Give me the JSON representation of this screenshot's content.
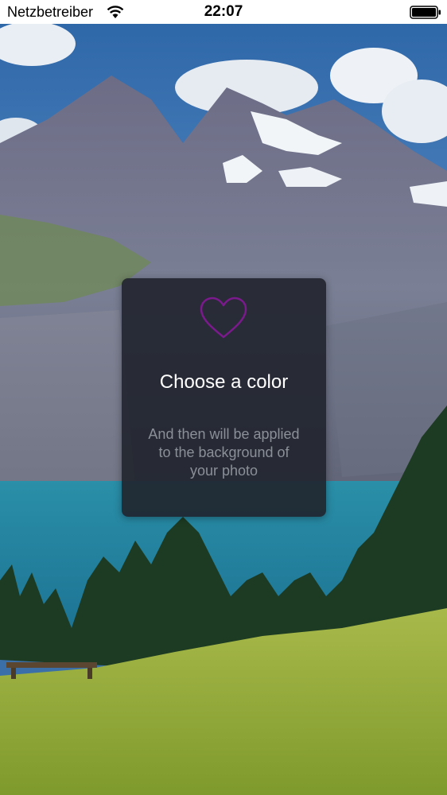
{
  "status_bar": {
    "carrier": "Netzbetreiber",
    "time": "22:07",
    "wifi_icon": "wifi-icon",
    "battery_icon": "battery-full-icon"
  },
  "background": {
    "icon": "mountain-lake-photo"
  },
  "card": {
    "icon": "heart-outline-icon",
    "icon_color": "#7a1a8c",
    "title": "Choose a color",
    "body": "And then will be applied to the background of your photo"
  }
}
